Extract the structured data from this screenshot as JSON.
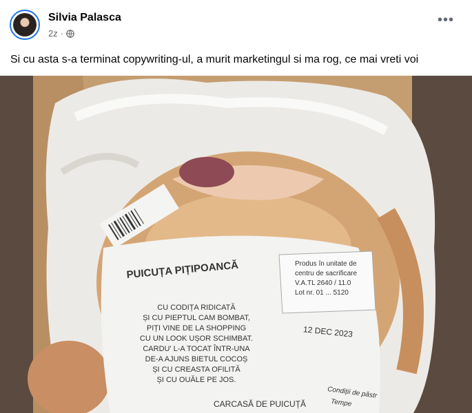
{
  "post": {
    "author": "Silvia Palasca",
    "time": "2z",
    "text": "Si cu asta s-a terminat copywriting-ul, a murit marketingul si ma rog, ce mai vreti voi",
    "more_icon": "more-horizontal-icon",
    "privacy_icon": "globe-icon"
  },
  "label": {
    "title": "PUICUȚA PIȚIPOANCĂ",
    "poem": [
      "CU CODIȚA RIDICATĂ",
      "ȘI CU PIEPTUL CAM BOMBAT,",
      "PIȚI VINE DE LA SHOPPING",
      "CU UN LOOK UȘOR SCHIMBAT.",
      "CARDU' L-A TOCAT ÎNTR-UNA",
      "DE-A AJUNS BIETUL COCOȘ",
      "ȘI CU CREASTA OFILITĂ",
      "ȘI CU OUĂLE PE JOS."
    ],
    "product_info": [
      "Produs în unitate de",
      "centru de sacrificare",
      "V.A.TL 2640 / 11.0",
      "Lot nr. 01 ... 5120"
    ],
    "date": "12 DEC 2023",
    "carcass": "CARCASĂ DE PUICUȚĂ",
    "conditions": "Condiții de păstr",
    "temp": "Tempe"
  }
}
